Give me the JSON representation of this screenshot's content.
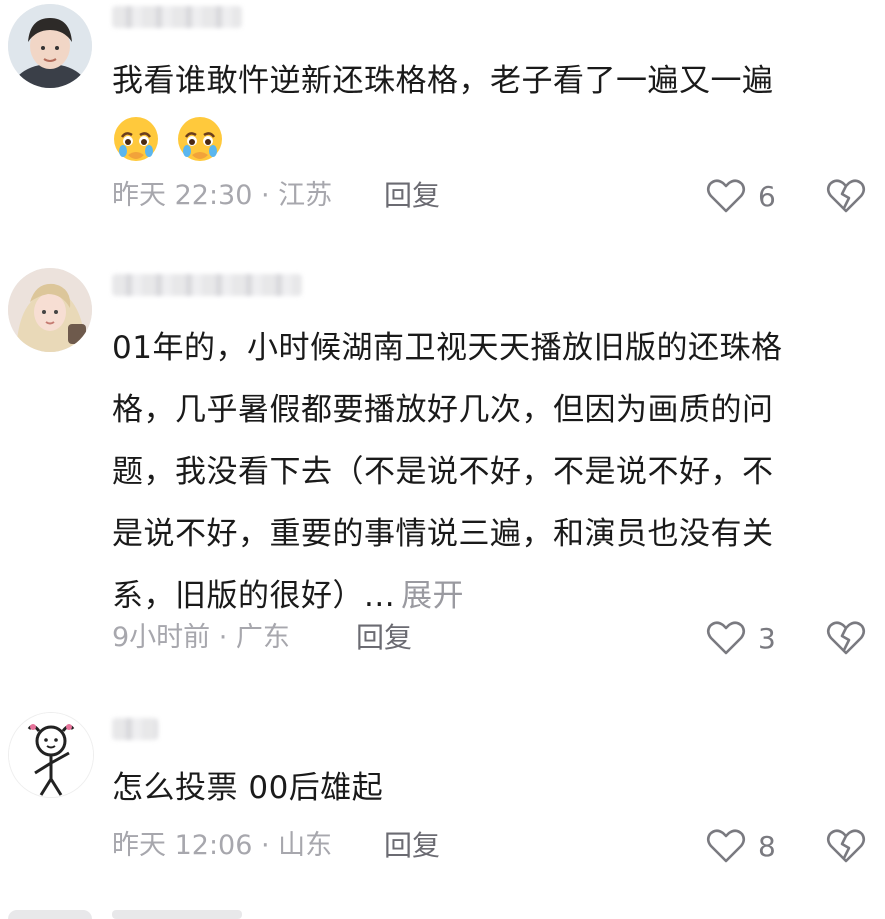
{
  "comments": [
    {
      "text_lines": [
        "我看谁敢忤逆新还珠格格，老子看了一遍又一遍"
      ],
      "emoji": [
        "face-holding-back-tears",
        "face-holding-back-tears"
      ],
      "time_location": "昨天 22:30 · 江苏",
      "reply_label": "回复",
      "like_count": "6"
    },
    {
      "text_lines": [
        "01年的，小时候湖南卫视天天播放旧版的还珠格",
        "格，几乎暑假都要播放好几次，但因为画质的问",
        "题，我没看下去（不是说不好，不是说不好，不",
        "是说不好，重要的事情说三遍，和演员也没有关",
        "系，旧版的很好）..."
      ],
      "expand_label": "展开",
      "time_location": "9小时前 · 广东",
      "reply_label": "回复",
      "like_count": "3"
    },
    {
      "text_lines": [
        "怎么投票 00后雄起"
      ],
      "time_location": "昨天 12:06 · 山东",
      "reply_label": "回复",
      "like_count": "8"
    }
  ],
  "icons": {
    "like": "heart-outline-icon",
    "dislike": "broken-heart-icon"
  },
  "colors": {
    "meta_text": "#a7a7ad",
    "reply_text": "#6b6b72",
    "body_text": "#1a1a1a"
  }
}
